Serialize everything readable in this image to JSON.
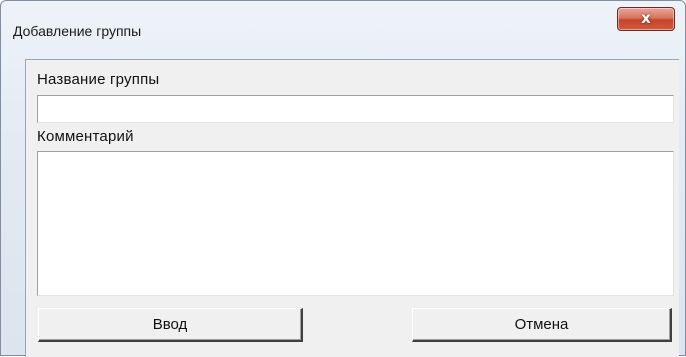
{
  "window": {
    "title": "Добавление группы",
    "close_icon": "close-icon",
    "close_glyph": "x"
  },
  "form": {
    "group_name_label": "Название группы",
    "group_name_value": "",
    "comment_label": "Комментарий",
    "comment_value": ""
  },
  "buttons": {
    "ok_label": "Ввод",
    "cancel_label": "Отмена"
  },
  "colors": {
    "close_button": "#c6442b",
    "frame": "#dbe4ef",
    "client": "#f0f0f0"
  }
}
